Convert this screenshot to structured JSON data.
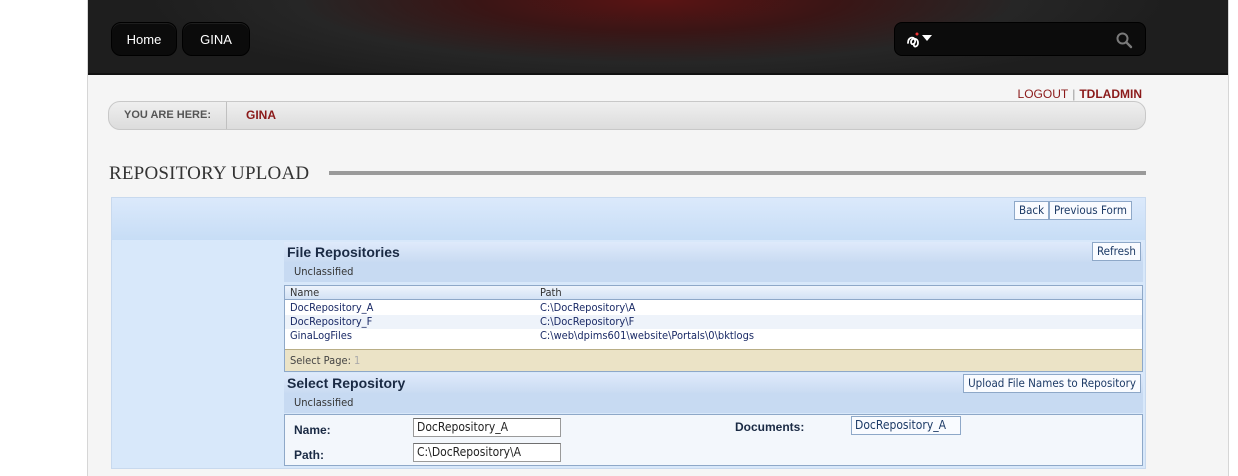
{
  "nav": {
    "home": "Home",
    "gina": "GINA"
  },
  "search": {
    "placeholder": ""
  },
  "login": {
    "logout": "LOGOUT",
    "separator": "|",
    "user": "TDLADMIN"
  },
  "breadcrumb": {
    "label": "YOU ARE HERE:",
    "current": "GINA"
  },
  "page": {
    "title": "REPOSITORY UPLOAD"
  },
  "form": {
    "back": "Back",
    "previous_form": "Previous Form"
  },
  "repositories": {
    "title": "File Repositories",
    "refresh": "Refresh",
    "classification": "Unclassified",
    "columns": [
      "Name",
      "Path"
    ],
    "rows": [
      {
        "name": "DocRepository_A",
        "path": "C:\\DocRepository\\A"
      },
      {
        "name": "DocRepository_F",
        "path": "C:\\DocRepository\\F"
      },
      {
        "name": "GinaLogFiles",
        "path": "C:\\web\\dpims601\\website\\Portals\\0\\bktlogs"
      }
    ],
    "pager_label": "Select Page:",
    "pager_page": "1"
  },
  "select": {
    "title": "Select Repository",
    "upload_button": "Upload File Names to Repository",
    "classification": "Unclassified",
    "name_label": "Name:",
    "name_value": "DocRepository_A",
    "path_label": "Path:",
    "path_value": "C:\\DocRepository\\A",
    "documents_label": "Documents:",
    "documents_value": "DocRepository_A"
  },
  "colors": {
    "accent": "#8b1a1a",
    "panel": "#d8e8fa",
    "topbar": "#262626"
  },
  "icons": {
    "language": "language-icon",
    "search": "search-icon"
  }
}
